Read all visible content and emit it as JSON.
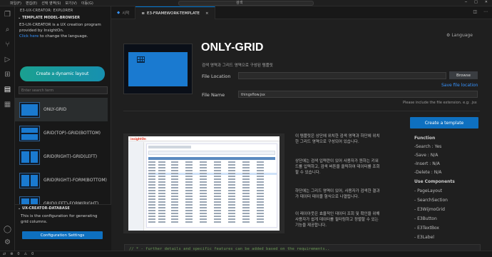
{
  "titlebar": {
    "menu": [
      "파일(F)",
      "편집(E)",
      "선택 영역(S)",
      "보기(V)",
      "이동(G)"
    ],
    "search": "검색"
  },
  "sidebar": {
    "title": "E3-UX-CREATOR: EXPLORER",
    "section": "TEMPLATE MODEL-BROWSER",
    "description": "E3-UX-CREATOR is a UX creation program provided by InsightOn.",
    "click_here": "Click here",
    "change_lang": " to change the language.",
    "create_button": "Create a dynamic layout",
    "search_placeholder": "Enter search term",
    "templates": [
      {
        "label": "ONLY-GRID"
      },
      {
        "label": "GRID(TOP)-GRID(BOTTOM)"
      },
      {
        "label": "GRID(RIGHT)-GRID(LEFT)"
      },
      {
        "label": "GRID(RIGHT)-FORM(BOTTOM)"
      },
      {
        "label": "GRID(LEFT)-FORM(RIGHT)"
      }
    ],
    "db_section": "UX-CREATOR-DATABASE",
    "db_description": "This is the configuration for generating grid columns.",
    "config_button": "Configuration Settings"
  },
  "status": {
    "errors": "0",
    "warnings": "0"
  },
  "tabs": [
    {
      "label": "시작"
    },
    {
      "label": "E3-FRAMEWORK-TEMPLATE",
      "close": "×"
    }
  ],
  "editor": {
    "language": "Language",
    "title": "ONLY-GRID",
    "subtitle": "검색 영역과 그리드 영역으로 구성된 템플릿",
    "file_location_label": "File Location",
    "file_location_value": "",
    "browse": "Browse",
    "save_location": "Save file location",
    "file_name_label": "File Name",
    "file_name_value": "thingsflow.jsx",
    "hint": "Please include the file extension. e.g: .jsx",
    "create_template": "Create a template",
    "description": [
      "이 템플릿은 상단에 위치한 검색 영역과 하단에 위치한 그리드 영역으로 구성되어 있습니다.",
      "상단에는 검색 입력란이 있어 사용자가 원하는 키워드를 입력하고, 검색 버튼을 클릭하여 데이터를 조회할 수 있습니다.",
      "하단에는 그리드 영역이 있어, 사용자가 검색한 결과가 데이터 테이블 형식으로 나열됩니다.",
      "이 레이아웃은 효율적인 데이터 조회 및 확인을 위해 사용자가 쉽게 데이터를 필터링하고 정렬할 수 있는 기능을 제공합니다."
    ],
    "function_title": "Function",
    "functions": [
      "-Search :  Yes",
      "-Save :  N/A",
      "-Insert :  N/A",
      "-Delete :  N/A"
    ],
    "components_title": "Use Components",
    "components": [
      "- PageLayout",
      "- SearchSection",
      "- E3WijmoGrid",
      "- E3Button",
      "- E3TextBox",
      "- E3Label"
    ],
    "code_comment": "// * - further details and specific features can be added based on the requirements.."
  },
  "preview_screenshot": {
    "logo": "insightOn"
  },
  "colors": {
    "accent": "#0e70c0",
    "teal": "#1aa090",
    "link": "#3794ff"
  }
}
